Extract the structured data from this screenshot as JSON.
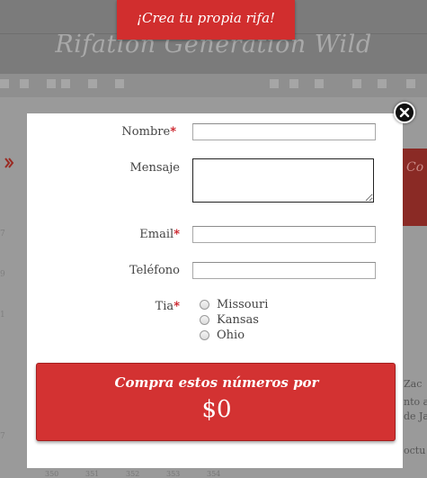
{
  "banner": {
    "text": "¡Crea tu propia rifa!"
  },
  "background": {
    "site_title": "Rifation Generation Wild",
    "right_tab_text": "Co",
    "side_numbers": [
      "7",
      "9",
      "1",
      "7"
    ],
    "side_text": [
      "Zac",
      "nto a",
      "de Ja",
      "octu"
    ],
    "bottom_numbers": [
      "350",
      "351",
      "352",
      "353",
      "354"
    ]
  },
  "modal": {
    "fields": {
      "nombre": {
        "label": "Nombre",
        "required": "*",
        "value": ""
      },
      "mensaje": {
        "label": "Mensaje",
        "value": ""
      },
      "email": {
        "label": "Email",
        "required": "*",
        "value": ""
      },
      "telefono": {
        "label": "Teléfono",
        "value": ""
      }
    },
    "tia": {
      "label": "Tia",
      "required": "*",
      "options": [
        "Missouri",
        "Kansas",
        "Ohio"
      ]
    },
    "buy_button": {
      "line1": "Compra estos números por",
      "price": "$0"
    }
  },
  "colors": {
    "accent": "#d12e2e",
    "overlay": "#9a9a9a",
    "required": "#c8121b"
  },
  "icons": {
    "close": "close-icon",
    "arrow": "arrow-icon"
  }
}
